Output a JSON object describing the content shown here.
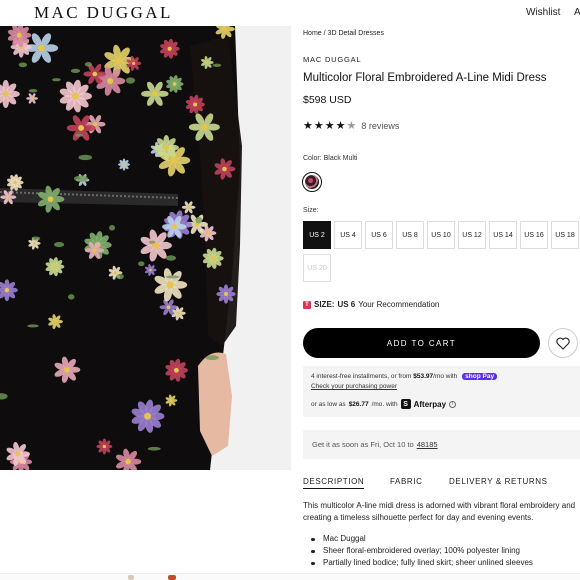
{
  "header": {
    "logo": "MAC DUGGAL",
    "wishlist_label": "Wishlist",
    "account_label": "A"
  },
  "breadcrumb": {
    "home": "Home",
    "separator": "/",
    "category": "3D Detail Dresses"
  },
  "product": {
    "brand": "MAC DUGGAL",
    "title": "Multicolor Floral Embroidered A-Line Midi Dress",
    "price": "$598 USD",
    "rating": 4.5,
    "reviews_label": "8 reviews",
    "color_label": "Color: Black Multi"
  },
  "sizes": {
    "label": "Size:",
    "options": [
      "US 2",
      "US 4",
      "US 6",
      "US 8",
      "US 10",
      "US 12",
      "US 14",
      "US 16",
      "US 18",
      "US 20"
    ],
    "selected": "US 2",
    "unavailable": [
      "US 20"
    ]
  },
  "size_rec": {
    "prefix": "SIZE:",
    "size": "US 6",
    "suffix": "Your Recommendation",
    "badge": "T"
  },
  "actions": {
    "add_to_cart": "ADD TO CART"
  },
  "payments": {
    "shoppay_text": "4 interest-free installments, or from",
    "shoppay_amount": "$53.97",
    "shoppay_suffix": "/mo with",
    "shoppay_brand": "shop Pay",
    "purchasing_power_link": "Check your purchasing power",
    "afterpay_prefix": "or as low as",
    "afterpay_amount": "$26.77",
    "afterpay_suffix": "/mo. with",
    "afterpay_icon": "S",
    "afterpay_brand": "Afterpay",
    "info_icon": "i"
  },
  "shipping": {
    "text": "Get it as soon as Fri, Oct 10 to",
    "zip": "48185"
  },
  "tabs": [
    "DESCRIPTION",
    "FABRIC",
    "DELIVERY & RETURNS"
  ],
  "description": {
    "text": "This multicolor A-line midi dress is adorned with vibrant floral embroidery and creating a timeless silhouette perfect for day and evening events.",
    "bullets": [
      "Mac Duggal",
      "Sheer floral-embroidered overlay; 100% polyester lining",
      "Partially lined bodice; fully lined skirt; sheer unlined sleeves"
    ]
  },
  "colors": {
    "accent": "#000000",
    "shoppay": "#5a31f4",
    "size_badge": "#d43a55"
  }
}
